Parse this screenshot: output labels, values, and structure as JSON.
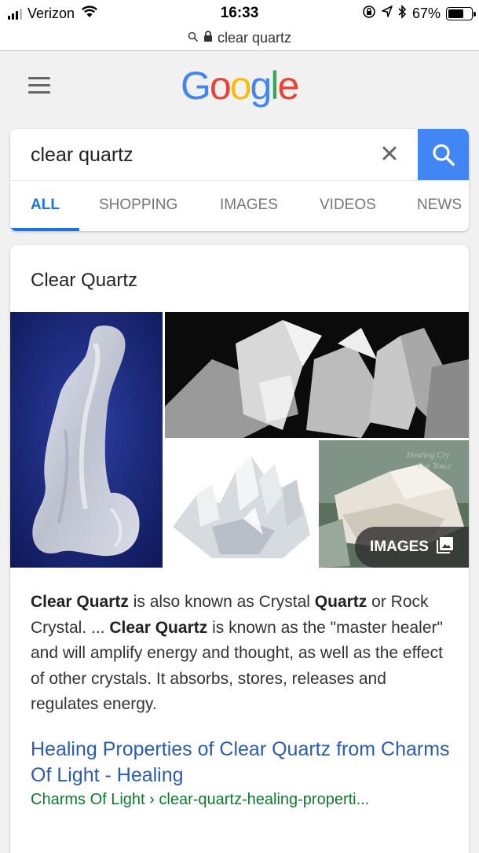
{
  "status_bar": {
    "carrier": "Verizon",
    "time": "16:33",
    "battery": "67%",
    "battery_level": 0.67
  },
  "url_bar": {
    "url": "clear quartz"
  },
  "header": {
    "logo_letters": [
      "G",
      "o",
      "o",
      "g",
      "l",
      "e"
    ],
    "logo_colors": [
      "#4285f4",
      "#ea4335",
      "#fbbc05",
      "#4285f4",
      "#34a853",
      "#ea4335"
    ]
  },
  "search": {
    "query": "clear quartz",
    "accent": "#4285f4"
  },
  "tabs": [
    {
      "label": "ALL",
      "active": true
    },
    {
      "label": "SHOPPING",
      "active": false
    },
    {
      "label": "IMAGES",
      "active": false
    },
    {
      "label": "VIDEOS",
      "active": false
    },
    {
      "label": "NEWS",
      "active": false
    }
  ],
  "knowledge_panel": {
    "title": "Clear Quartz",
    "images_label": "IMAGES",
    "image_watermark_1": "Healing Cry",
    "image_watermark_2": "For You.c",
    "description": {
      "part1_bold": "Clear Quartz",
      "part2": " is also known as Crystal ",
      "part3_bold": "Quartz",
      "part4": " or Rock Crystal. ... ",
      "part5_bold": "Clear Quartz",
      "part6": " is known as the \"master healer\" and will amplify energy and thought, as well as the effect of other crystals. It absorbs, stores, releases and regulates energy."
    },
    "result_title": "Healing Properties of Clear Quartz from Charms Of Light - Healing",
    "result_site": "Charms Of Light",
    "result_separator": " › ",
    "result_path": "clear-quartz-healing-properti..."
  }
}
